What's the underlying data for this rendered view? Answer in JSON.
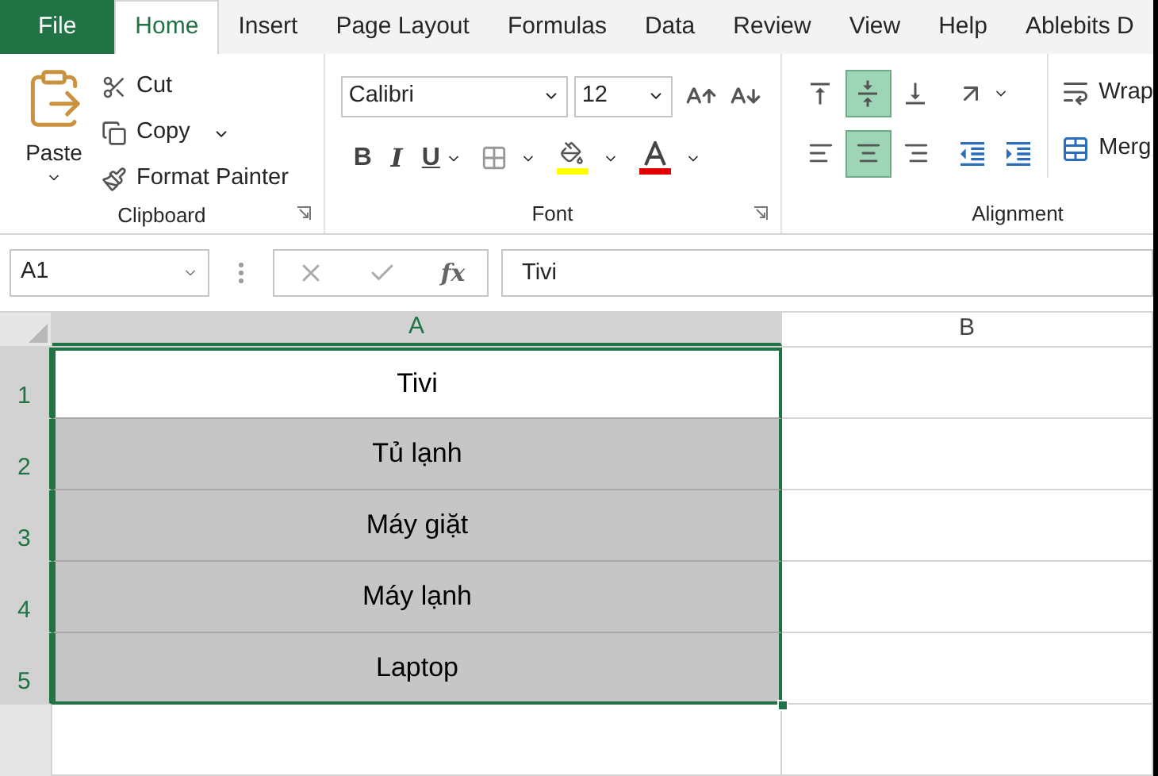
{
  "tabs": [
    {
      "label": "File",
      "kind": "file",
      "selected": false
    },
    {
      "label": "Home",
      "kind": "tab",
      "selected": true
    },
    {
      "label": "Insert",
      "kind": "tab",
      "selected": false
    },
    {
      "label": "Page Layout",
      "kind": "tab",
      "selected": false
    },
    {
      "label": "Formulas",
      "kind": "tab",
      "selected": false
    },
    {
      "label": "Data",
      "kind": "tab",
      "selected": false
    },
    {
      "label": "Review",
      "kind": "tab",
      "selected": false
    },
    {
      "label": "View",
      "kind": "tab",
      "selected": false
    },
    {
      "label": "Help",
      "kind": "tab",
      "selected": false
    },
    {
      "label": "Ablebits D",
      "kind": "tab",
      "selected": false
    }
  ],
  "clipboard": {
    "paste_label": "Paste",
    "group_label": "Clipboard",
    "items": [
      {
        "kind": "cut",
        "label": "Cut",
        "dropdown": false
      },
      {
        "kind": "copy",
        "label": "Copy",
        "dropdown": true
      },
      {
        "kind": "format_painter",
        "label": "Format Painter",
        "dropdown": false
      }
    ]
  },
  "font": {
    "group_label": "Font",
    "font_name": "Calibri",
    "font_size": "12",
    "styles": [
      {
        "kind": "bold",
        "label": "B"
      },
      {
        "kind": "italic",
        "label": "I"
      },
      {
        "kind": "underline",
        "label": "U"
      }
    ]
  },
  "alignment": {
    "group_label": "Alignment",
    "vertical": [
      {
        "kind": "top",
        "selected": false
      },
      {
        "kind": "middle",
        "selected": true
      },
      {
        "kind": "bottom",
        "selected": false
      }
    ],
    "horizontal": [
      {
        "kind": "left",
        "selected": false
      },
      {
        "kind": "center",
        "selected": true
      },
      {
        "kind": "right",
        "selected": false
      }
    ],
    "wrap_label": "Wrap",
    "merge_label": "Merg"
  },
  "formula_bar": {
    "name_box": "A1",
    "fx_label": "fx",
    "formula": "Tivi"
  },
  "sheet": {
    "columns": [
      {
        "label": "A",
        "selected": true
      },
      {
        "label": "B",
        "selected": false
      }
    ],
    "rows": [
      {
        "header": "1",
        "selected": true,
        "cells": [
          {
            "text": "Tivi",
            "active": true
          }
        ]
      },
      {
        "header": "2",
        "selected": true,
        "cells": [
          {
            "text": "Tủ lạnh",
            "active": false
          }
        ]
      },
      {
        "header": "3",
        "selected": true,
        "cells": [
          {
            "text": "Máy giặt",
            "active": false
          }
        ]
      },
      {
        "header": "4",
        "selected": true,
        "cells": [
          {
            "text": "Máy lạnh",
            "active": false
          }
        ]
      },
      {
        "header": "5",
        "selected": true,
        "cells": [
          {
            "text": "Laptop",
            "active": false
          }
        ]
      }
    ]
  }
}
